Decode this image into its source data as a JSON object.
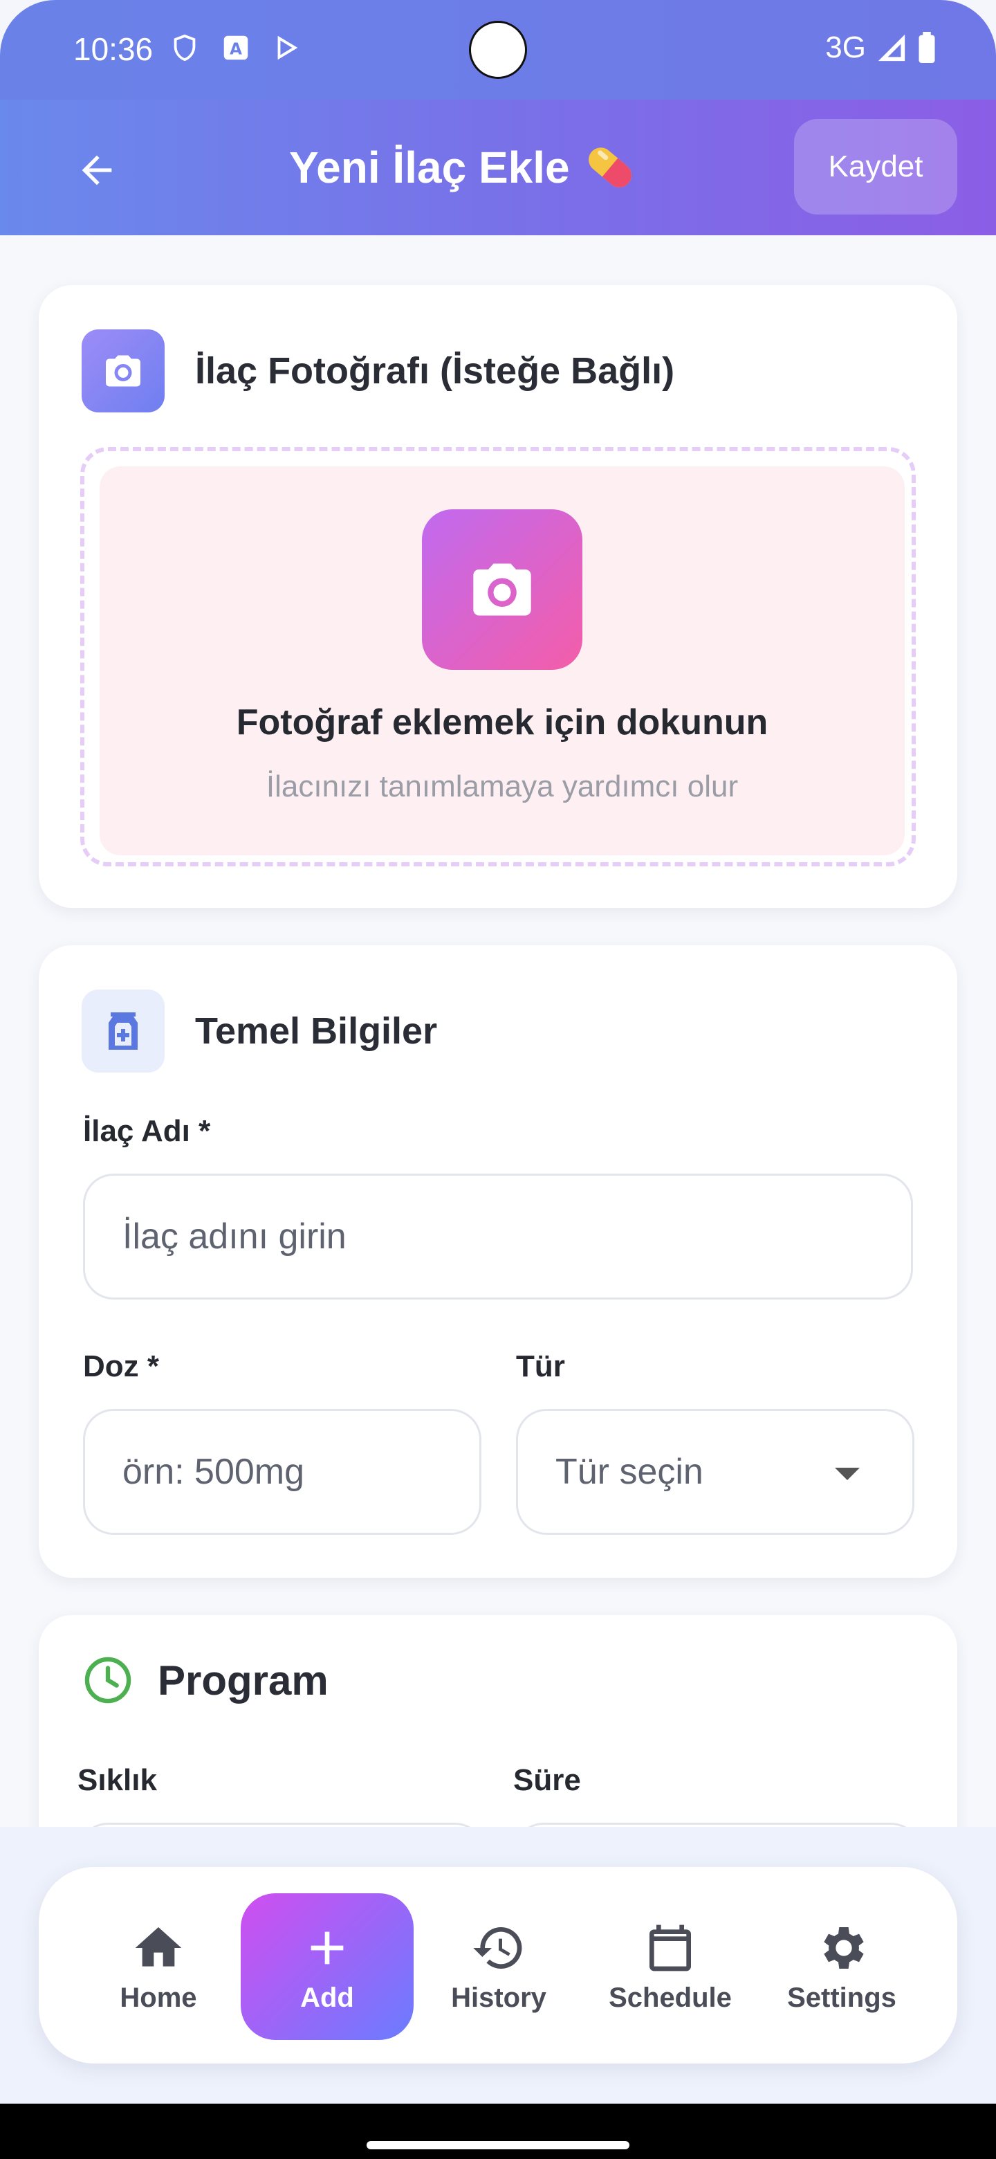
{
  "status_bar": {
    "time": "10:36",
    "network": "3G"
  },
  "app_bar": {
    "title": "Yeni İlaç Ekle",
    "save_label": "Kaydet"
  },
  "photo_card": {
    "title": "İlaç Fotoğrafı (İsteğe Bağlı)",
    "upload_title": "Fotoğraf eklemek için dokunun",
    "upload_subtitle": "İlacınızı tanımlamaya yardımcı olur"
  },
  "basic_card": {
    "title": "Temel Bilgiler",
    "name_label": "İlaç Adı *",
    "name_placeholder": "İlaç adını girin",
    "dose_label": "Doz *",
    "dose_placeholder": "örn: 500mg",
    "type_label": "Tür",
    "type_value": "Tür seçin"
  },
  "program_card": {
    "title": "Program",
    "frequency_label": "Sıklık",
    "duration_label": "Süre"
  },
  "bottom_nav": {
    "items": [
      {
        "label": "Home",
        "icon": "home-icon"
      },
      {
        "label": "Add",
        "icon": "plus-icon"
      },
      {
        "label": "History",
        "icon": "history-icon"
      },
      {
        "label": "Schedule",
        "icon": "calendar-icon"
      },
      {
        "label": "Settings",
        "icon": "gear-icon"
      }
    ],
    "active_index": 1
  },
  "colors": {
    "header_start": "#6a89ec",
    "header_end": "#8b5ee6",
    "accent_pink": "#f45da8",
    "accent_purple": "#c06af0",
    "program_green": "#4caf50"
  }
}
